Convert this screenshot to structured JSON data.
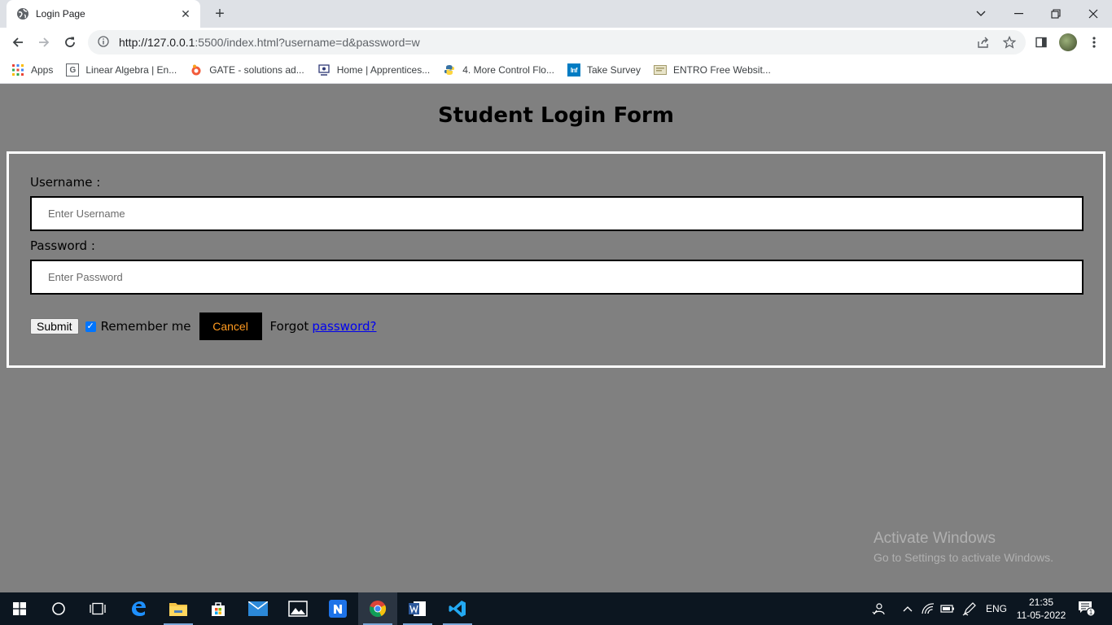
{
  "browser": {
    "tab_title": "Login Page",
    "url_main": "http://127.0.0.1",
    "url_rest": ":5500/index.html?username=d&password=w",
    "bookmarks": [
      {
        "label": "Apps",
        "icon": "apps-grid-icon"
      },
      {
        "label": "Linear Algebra | En...",
        "icon": "g-letter-icon"
      },
      {
        "label": "GATE - solutions ad...",
        "icon": "gate-logo-icon"
      },
      {
        "label": "Home | Apprentices...",
        "icon": "apprentice-logo-icon"
      },
      {
        "label": "4. More Control Flo...",
        "icon": "python-logo-icon"
      },
      {
        "label": "Take Survey",
        "icon": "infosys-logo-icon"
      },
      {
        "label": "ENTRO Free Websit...",
        "icon": "entro-logo-icon"
      }
    ]
  },
  "page": {
    "heading": "Student Login Form",
    "username_label": "Username :",
    "username_placeholder": "Enter Username",
    "password_label": "Password :",
    "password_placeholder": "Enter Password",
    "submit_label": "Submit",
    "remember_label": "Remember me",
    "remember_checked": true,
    "cancel_label": "Cancel",
    "forgot_text": "Forgot",
    "forgot_link": "password?"
  },
  "watermark": {
    "line1": "Activate Windows",
    "line2": "Go to Settings to activate Windows."
  },
  "taskbar": {
    "lang": "ENG",
    "time": "21:35",
    "date": "11-05-2022",
    "notification_count": "1"
  }
}
